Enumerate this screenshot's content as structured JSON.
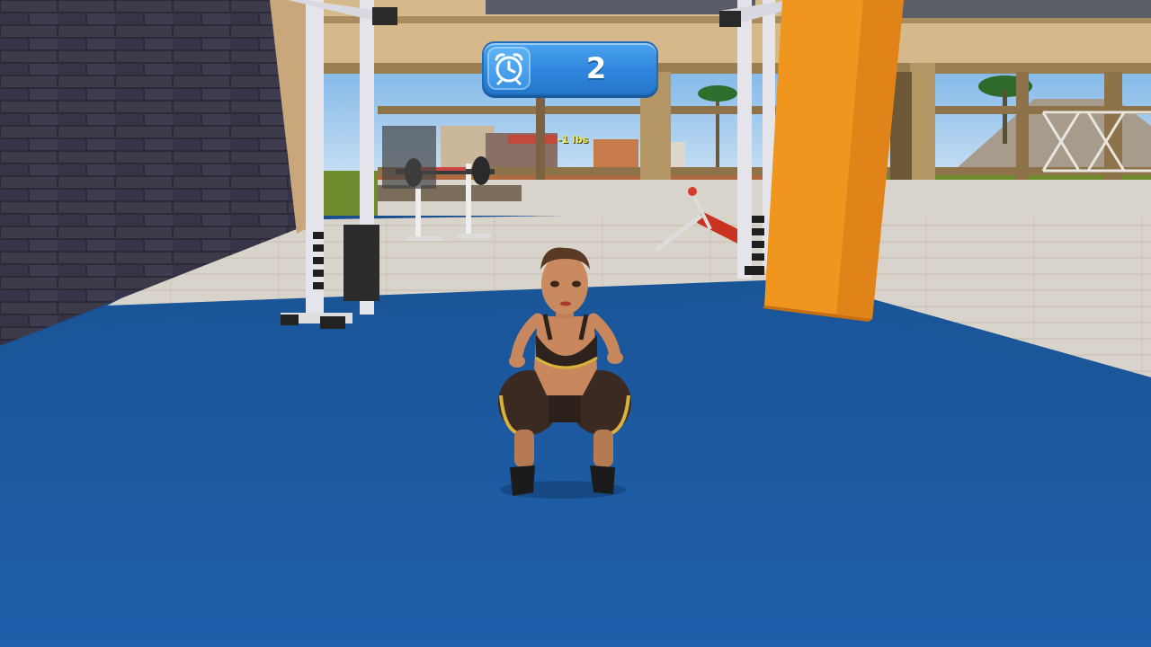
{
  "hud": {
    "timer_icon": "alarm-clock-icon",
    "timer_value": "2"
  },
  "world": {
    "floating_feedback": "-1 lbs"
  },
  "colors": {
    "mat": "#1d5aa3",
    "pillar": "#ef9420",
    "hud_blue": "#2f86dc"
  }
}
